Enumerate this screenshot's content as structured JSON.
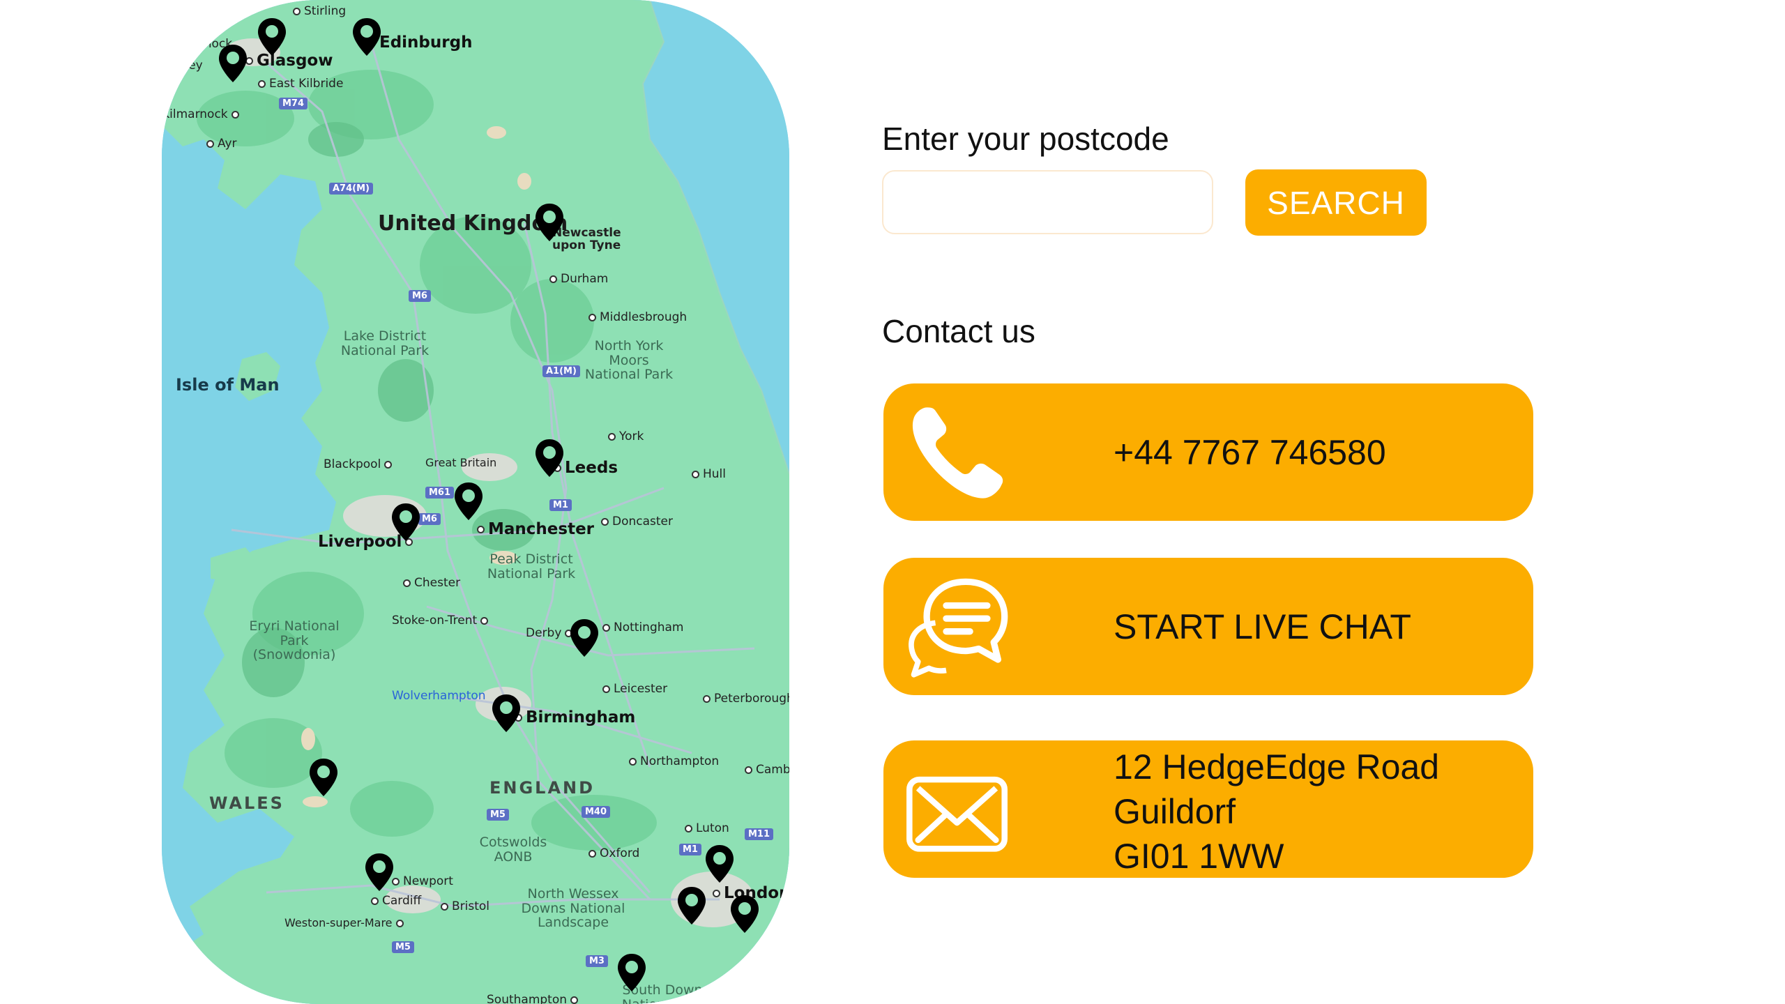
{
  "map": {
    "places": {
      "stirling": "Stirling",
      "greenock": "Greenock",
      "glasgow": "Glasgow",
      "edinburgh": "Edinburgh",
      "paisley": "Paisley",
      "east_kilbride": "East Kilbride",
      "kilmarnock": "Kilmarnock",
      "ayr": "Ayr",
      "united_kingdom": "United Kingdom",
      "newcastle": "Newcastle upon Tyne",
      "durham": "Durham",
      "middlesbrough": "Middlesbrough",
      "lake_district": "Lake District National Park",
      "north_york_moors": "North York Moors National Park",
      "isle_of_man": "Isle of Man",
      "york": "York",
      "blackpool": "Blackpool",
      "great_britain": "Great Britain",
      "leeds": "Leeds",
      "hull": "Hull",
      "doncaster": "Doncaster",
      "liverpool": "Liverpool",
      "manchester": "Manchester",
      "peak_district": "Peak District National Park",
      "chester": "Chester",
      "eryri": "Eryri National Park (Snowdonia)",
      "stoke": "Stoke-on-Trent",
      "derby": "Derby",
      "nottingham": "Nottingham",
      "leicester": "Leicester",
      "wolverhampton": "Wolverhampton",
      "birmingham": "Birmingham",
      "peterborough": "Peterborough",
      "northampton": "Northampton",
      "cambridge": "Cambridge",
      "wales": "WALES",
      "england": "ENGLAND",
      "luton": "Luton",
      "cotswolds": "Cotswolds AONB",
      "oxford": "Oxford",
      "newport": "Newport",
      "cardiff": "Cardiff",
      "bristol": "Bristol",
      "north_wessex": "North Wessex Downs National Landscape",
      "london": "London",
      "weston": "Weston-super-Mare",
      "south_downs": "South Downs National Park",
      "southampton": "Southampton"
    },
    "roads": {
      "m74": "M74",
      "a74m": "A74(M)",
      "m6_north": "M6",
      "a1m": "A1(M)",
      "m61": "M61",
      "m6_mid": "M6",
      "m1_north": "M1",
      "m5": "M5",
      "m40": "M40",
      "m1_south": "M1",
      "m11": "M11",
      "m5_south": "M5",
      "m3": "M3"
    },
    "pin_color": "#000000",
    "land_color": "#8ee0b4",
    "water_color": "#7fd3e6"
  },
  "postcode": {
    "label": "Enter your postcode",
    "value": "",
    "placeholder": "",
    "button_label": "SEARCH"
  },
  "contact": {
    "title": "Contact us",
    "phone": "+44 7767 746580",
    "chat_label": "START LIVE CHAT",
    "address_lines": [
      "12 HedgeEdge Road",
      "Guildorf",
      "GI01 1WW"
    ],
    "icons": {
      "phone": "phone-icon",
      "chat": "chat-bubbles-icon",
      "email": "envelope-icon"
    },
    "accent_color": "#fcad00"
  }
}
